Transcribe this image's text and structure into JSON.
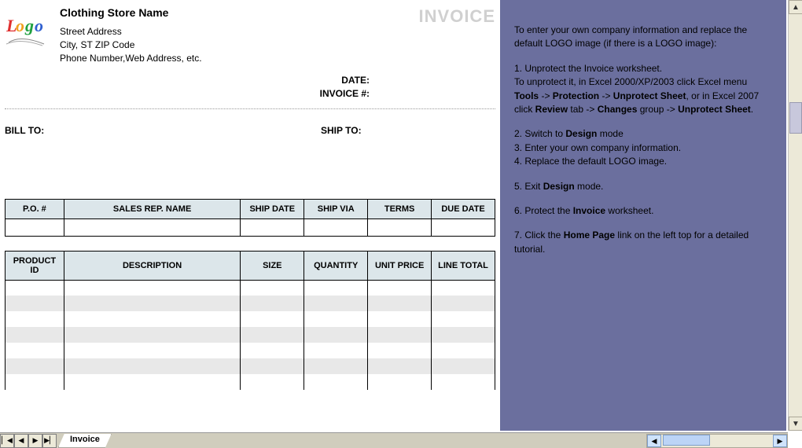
{
  "company": {
    "name": "Clothing Store Name",
    "street": "Street Address",
    "citystzip": "City, ST  ZIP Code",
    "phone": "Phone Number,Web Address, etc."
  },
  "invoice_title": "INVOICE",
  "labels": {
    "date": "DATE:",
    "invoice_no": "INVOICE #:",
    "bill_to": "BILL TO:",
    "ship_to": "SHIP TO:"
  },
  "order_headers": {
    "po": "P.O. #",
    "rep": "SALES REP. NAME",
    "shipdate": "SHIP DATE",
    "shipvia": "SHIP VIA",
    "terms": "TERMS",
    "due": "DUE DATE"
  },
  "item_headers": {
    "pid": "PRODUCT ID",
    "desc": "DESCRIPTION",
    "size": "SIZE",
    "qty": "QUANTITY",
    "price": "UNIT PRICE",
    "total": "LINE TOTAL"
  },
  "help": {
    "intro": "To enter your own company information and replace the default LOGO image (if there is a LOGO image):",
    "s1a": "1. Unprotect the Invoice worksheet.",
    "s1b": "To unprotect it, in Excel 2000/XP/2003 click Excel menu ",
    "s1_tools": "Tools",
    "s1_arrow1": " -> ",
    "s1_protection": "Protection",
    "s1_arrow2": " -> ",
    "s1_unprotect1": "Unprotect Sheet",
    "s1_or": ", or in Excel 2007 click ",
    "s1_review": "Review",
    "s1_tab": " tab -> ",
    "s1_changes": "Changes",
    "s1_group": " group -> ",
    "s1_unprotect2": "Unprotect Sheet",
    "s1_period": ".",
    "s2a": "2. Switch to ",
    "s2_design": "Design",
    "s2b": " mode",
    "s3": "3. Enter your own company information.",
    "s4": "4. Replace the default LOGO image.",
    "s5a": "5. Exit ",
    "s5_design": "Design",
    "s5b": " mode.",
    "s6a": "6. Protect the ",
    "s6_invoice": "Invoice",
    "s6b": " worksheet.",
    "s7a": "7. Click the ",
    "s7_home": "Home Page",
    "s7b": " link on the left top for a detailed tutorial."
  },
  "tab_name": "Invoice"
}
